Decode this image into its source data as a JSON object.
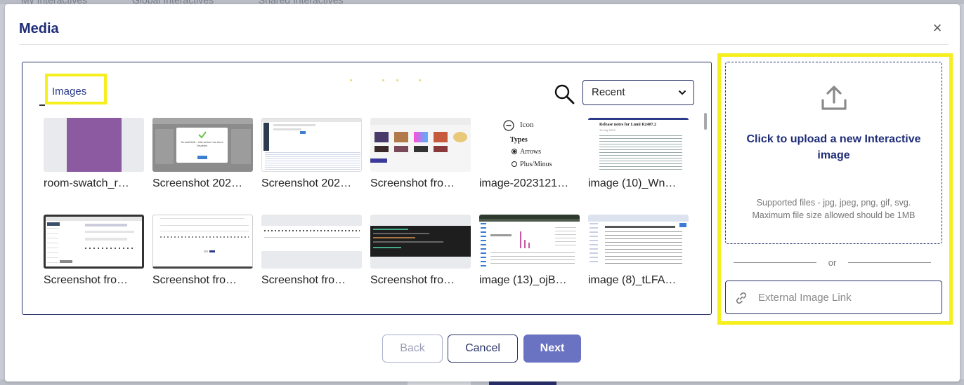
{
  "modal": {
    "title": "Media",
    "close_symbol": "×"
  },
  "gallery": {
    "tab_label": "Images",
    "sort_selected": "Recent",
    "items": [
      {
        "name": "room-swatch_r…",
        "thumb": "purple-swatch"
      },
      {
        "name": "Screenshot 202…",
        "thumb": "screenshot-dialog"
      },
      {
        "name": "Screenshot 202…",
        "thumb": "screenshot-code"
      },
      {
        "name": "Screenshot fro…",
        "thumb": "screenshot-gallery"
      },
      {
        "name": "image-2023121…",
        "thumb": "icon-types"
      },
      {
        "name": "image (10)_Wn…",
        "thumb": "release-notes"
      },
      {
        "name": "Screenshot fro…",
        "thumb": "screenshot-form"
      },
      {
        "name": "Screenshot fro…",
        "thumb": "screenshot-page"
      },
      {
        "name": "Screenshot fro…",
        "thumb": "screenshot-toolbar"
      },
      {
        "name": "Screenshot fro…",
        "thumb": "screenshot-terminal"
      },
      {
        "name": "image (13)_ojB…",
        "thumb": "screenshot-analytics"
      },
      {
        "name": "image (8)_tLFA…",
        "thumb": "screenshot-doc"
      }
    ],
    "thumb_texts": {
      "dialog_caption": "Tenant2608 - Interaction has been Disabled",
      "icon_label": "Icon",
      "types_heading": "Types",
      "option_arrows": "Arrows",
      "option_plusminus": "Plus/Minus",
      "notes_heading": "Release notes for Lumi R2407.2",
      "notes_date": "19 July 2024"
    }
  },
  "upload": {
    "title": "Click to upload a new Interactive image",
    "hint_line1": "Supported files - jpg, jpeg, png, gif, svg.",
    "hint_line2": "Maximum file size allowed should be 1MB",
    "or_text": "or",
    "external_placeholder": "External Image Link"
  },
  "footer": {
    "back_label": "Back",
    "cancel_label": "Cancel",
    "next_label": "Next"
  },
  "background": {
    "tabs": [
      "My Interactives",
      "Global Interactives",
      "Shared Interactives"
    ]
  },
  "colors": {
    "accent": "#1f2d78",
    "highlight": "#f6ef1e",
    "next_button": "#6a72c2",
    "border": "#2c3569"
  }
}
